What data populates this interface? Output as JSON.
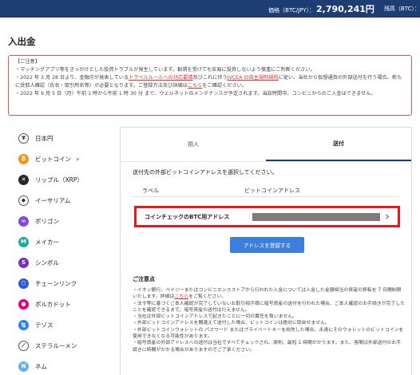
{
  "topbar": {
    "price_label": "価格（BTC/JPY）：",
    "price_value": "2,790,241円",
    "balance_label": "残高（BTC）："
  },
  "page_title": "入出金",
  "notice": {
    "title": "【ご注意】",
    "line1": "・マッチングアプリ等をきっかけとした投資トラブルが発生しています。勧誘を受けても安易に投資しないよう慎重にご判断ください。",
    "line2_a": "・2022 年 3 月 28 日より、金融庁が発表している",
    "line2_link1": "トラベルルールへの対応要請",
    "line2_b": "及びこれに伴う",
    "line2_link2": "JVCEA の自主規制規則",
    "line2_c": "に従い、当社から仮想通貨の外部送付を行う場合、新たに受取人確認（氏名・取引所名等）が必要となります。ご登録方法及び詳細は",
    "line2_link3": "こちら",
    "line2_d": "をご確認ください。",
    "line3": "・2022 年 9 月 5 日（月）午前 1 時から午前 1 時 30 分 まで、ウェルネットのメンテナンスが予定されます。当該時間中、コンビニからのご入金はできません。"
  },
  "sidebar": {
    "items": [
      {
        "label": "日本円",
        "icon": "yen-icon",
        "symbol": "¥",
        "color": "#ffffff"
      },
      {
        "label": "ビットコイン",
        "icon": "bitcoin-icon",
        "symbol": "₿",
        "color": "#f7931a"
      },
      {
        "label": "リップル（XRP）",
        "icon": "ripple-icon",
        "symbol": "✕",
        "color": "#23292f"
      },
      {
        "label": "イーサリアム",
        "icon": "ethereum-icon",
        "symbol": "◆",
        "color": "#ffffff"
      },
      {
        "label": "ポリゴン",
        "icon": "polygon-icon",
        "symbol": "∞",
        "color": "#8247e5"
      },
      {
        "label": "メイカー",
        "icon": "maker-icon",
        "symbol": "M",
        "color": "#1aab9b"
      },
      {
        "label": "シンボル",
        "icon": "symbol-icon",
        "symbol": "S",
        "color": "#7b2cbf"
      },
      {
        "label": "チェーンリンク",
        "icon": "chainlink-icon",
        "symbol": "⬡",
        "color": "#2a5ada"
      },
      {
        "label": "ポルカドット",
        "icon": "polkadot-icon",
        "symbol": "●",
        "color": "#e6007a"
      },
      {
        "label": "テゾス",
        "icon": "tezos-icon",
        "symbol": "ꜩ",
        "color": "#2c7df7"
      },
      {
        "label": "ステラルーメン",
        "icon": "stellar-icon",
        "symbol": "⟋",
        "color": "#ffffff"
      },
      {
        "label": "ネム",
        "icon": "nem-icon",
        "symbol": "N",
        "color": "#67b2e8"
      }
    ],
    "chevron": "»"
  },
  "panel": {
    "tab_deposit": "預入",
    "tab_send": "送付",
    "instruction": "送付先の外部ビットコインアドレスを選択してください。",
    "col_label": "ラベル",
    "col_address": "ビットコインアドレス",
    "row_name": "コインチェックのBTC用アドレス",
    "row_chevron": "›",
    "register_button": "アドレスを登録する",
    "notes_title": "ご注意点",
    "note1_a": "・イオン銀行、ペイジーまたはコンビニエンスストアから行われた入金については入金した金額相当の資産の移転を 7 日間制限いたします。詳細は",
    "note1_link": "こちら",
    "note1_b": "をご覧ください。",
    "note2": "・法令等に基づくご本人確認が完了していないお取引相手様に暗号資産の送付を行われた場合、ご本人確認のお手続きが完了したことを確認できるまで、暗号資産の送付は行えません。",
    "note3": "・当社は外部ビットコインアドレスで起きたことに一切の責任を負いません。",
    "note4": "・外部ビットコインアドレスを間違えて送付した場合、ビットコインは絶対に取戻せません。",
    "note5": "・外部ビットコインウォレットの パスワード またはプライベートキーを紛失した場合、永遠にそのウォレットのビットコインを使用できなくなる可能性があります。",
    "note6": "・暗号資産の外部アドレスへの送付は当社ですべてチェックされ、原則、最短 1 時間かかります。また、客間は外部送付のお手続きに時間がかかる場合がありますのでご了承ください。"
  }
}
